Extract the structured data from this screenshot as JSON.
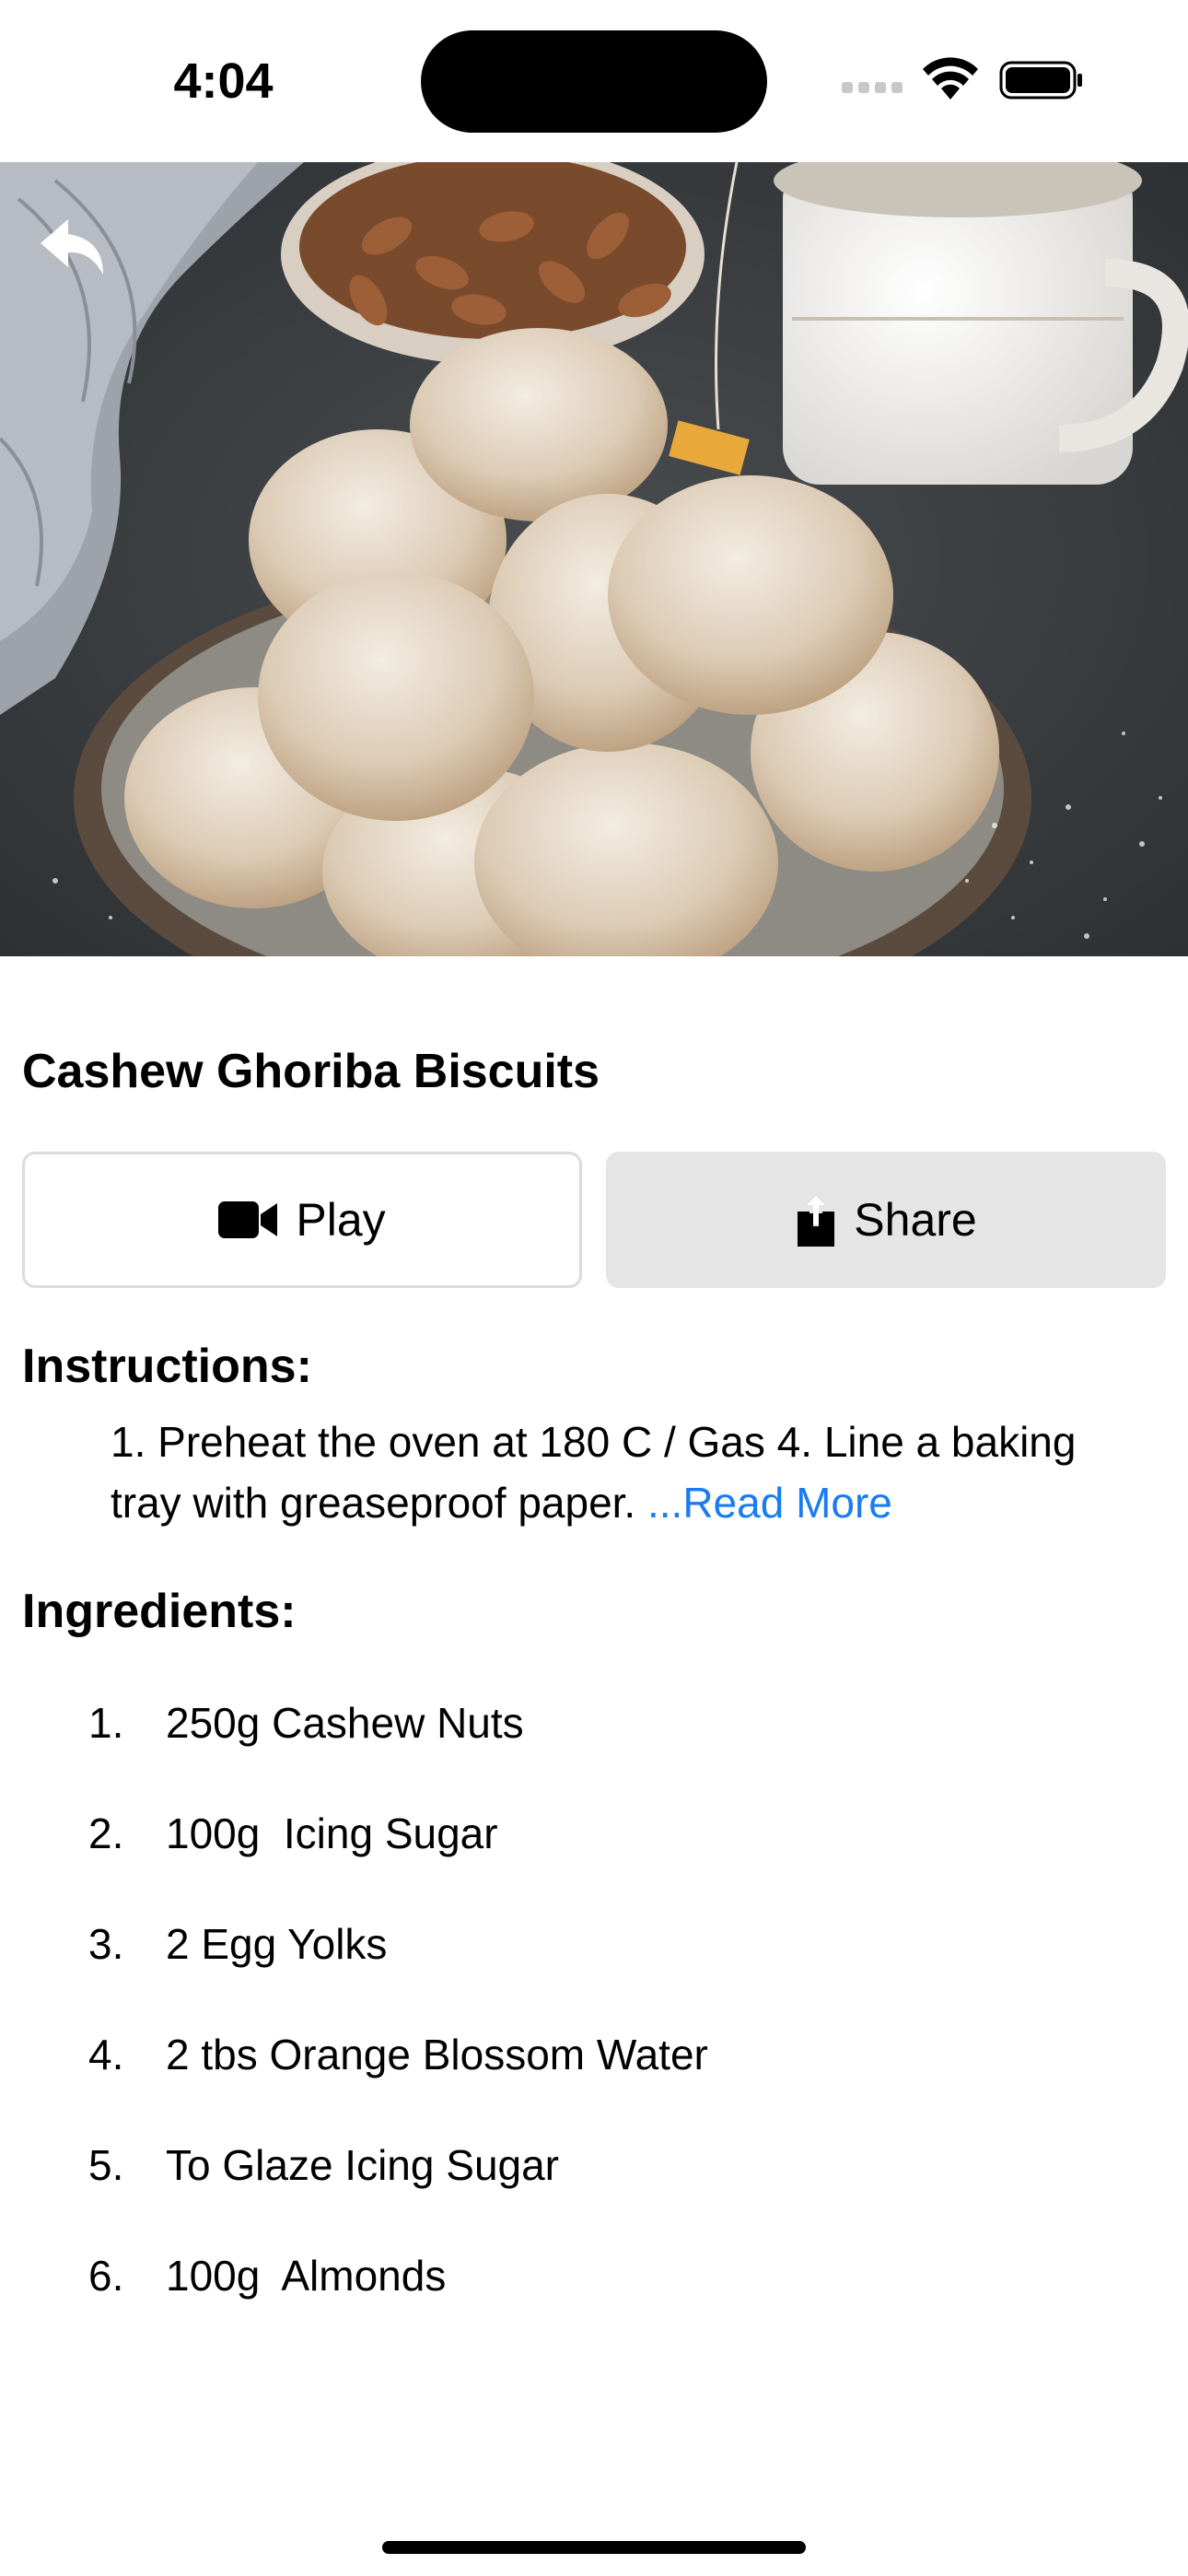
{
  "status_bar": {
    "time": "4:04"
  },
  "hero": {
    "image_description_icon": "cookie-photo",
    "back_icon": "back-arrow-icon"
  },
  "recipe": {
    "title": "Cashew Ghoriba Biscuits"
  },
  "actions": {
    "play_label": "Play",
    "play_icon": "video-camera-icon",
    "share_label": "Share",
    "share_icon": "share-icon"
  },
  "instructions": {
    "heading": "Instructions:",
    "text": "1. Preheat the oven at 180 C / Gas 4. Line a baking tray with greaseproof paper. ",
    "read_more": "...Read More"
  },
  "ingredients": {
    "heading": "Ingredients:",
    "items": [
      {
        "num": "1.",
        "text": "250g Cashew Nuts"
      },
      {
        "num": "2.",
        "text": "100g  Icing Sugar"
      },
      {
        "num": "3.",
        "text": "2 Egg Yolks"
      },
      {
        "num": "4.",
        "text": "2 tbs Orange Blossom Water"
      },
      {
        "num": "5.",
        "text": "To Glaze Icing Sugar"
      },
      {
        "num": "6.",
        "text": "100g  Almonds"
      }
    ]
  },
  "colors": {
    "link": "#1a7cf0",
    "share_bg": "#e5e5e5",
    "play_border": "#dcdcdc"
  }
}
